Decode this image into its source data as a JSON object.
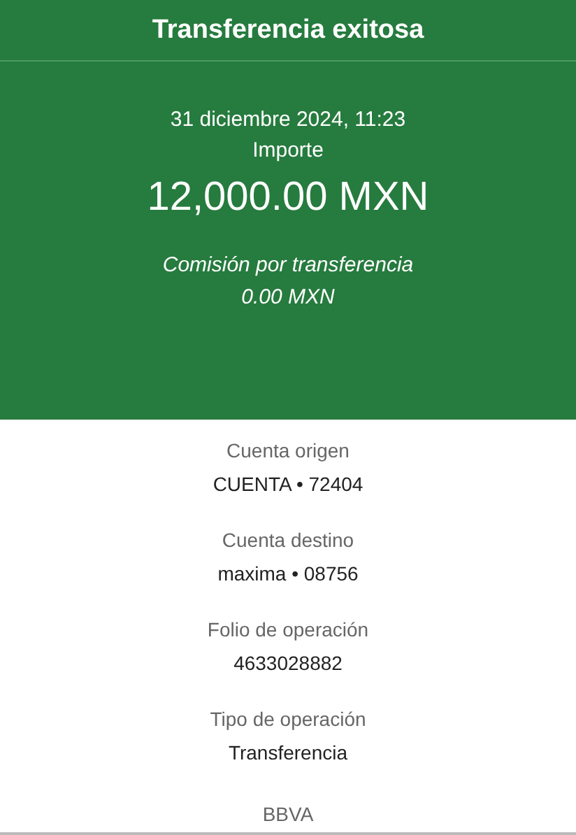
{
  "header": {
    "title": "Transferencia exitosa"
  },
  "summary": {
    "date": "31 diciembre 2024, 11:23",
    "amount_label": "Importe",
    "amount": "12,000.00 MXN",
    "fee_label": "Comisión por transferencia",
    "fee": "0.00 MXN"
  },
  "details": [
    {
      "label": "Cuenta origen",
      "value": "CUENTA • 72404"
    },
    {
      "label": "Cuenta destino",
      "value": "maxima • 08756"
    },
    {
      "label": "Folio de operación",
      "value": "4633028882"
    },
    {
      "label": "Tipo de operación",
      "value": "Transferencia"
    }
  ],
  "footer": {
    "bank": "BBVA"
  }
}
